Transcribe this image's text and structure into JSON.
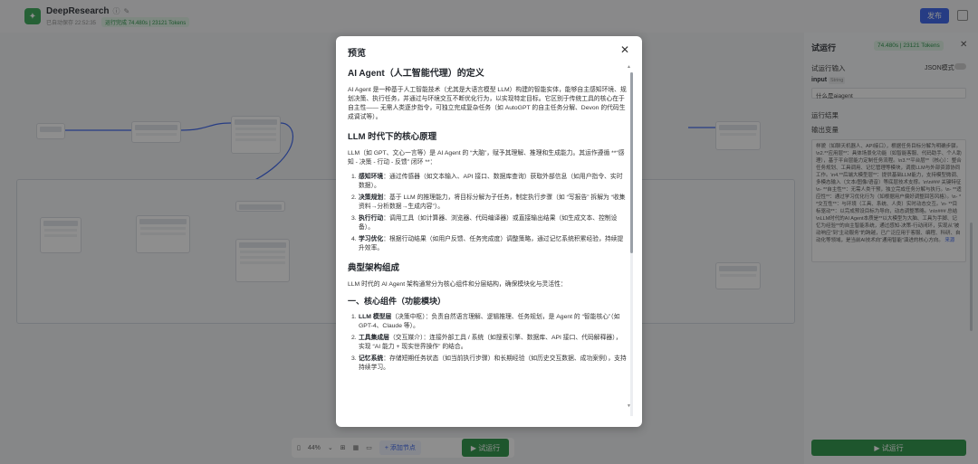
{
  "app": {
    "title": "DeepResearch",
    "save_status": "已自动保存 22:52:35",
    "run_status": "运行完成 74.480s | 23121 Tokens",
    "publish_label": "发布"
  },
  "toolbar": {
    "zoom": "44%",
    "add_node_label": "+ 添加节点",
    "run_label": "▶ 试运行"
  },
  "right_panel": {
    "title": "试运行",
    "status": "74.480s | 23121 Tokens",
    "input_section": "试运行输入",
    "json_mode_label": "JSON模式",
    "input_key": "input",
    "input_type": "String",
    "input_value": "什么是aiagent",
    "results_section": "运行结果",
    "output_label": "输出变量",
    "output_text": "样貌（如聊天机器人、API接口），根据任务目标分解为明确步骤。\\n2.**应用层**：具体场景化功能（如智能客服、代码助手、个人助理），基于平台层能力定制任务流程。\\n3.**平台层**（核心）：整合任务规划、工具调用、记忆管理等模块，调度LLM与外部资源协同工作。\\n4.**后端大模型层**：提供基础LLM能力，支持模型微调、多模态输入（文本/图像/语音）等底层技术支撑。\\n\\n### 关键特征 \\n- **自主性**：无需人类干预，独立完成任务分解与执行。\\n- **适应性**：通过学习优化行为（如根据用户偏好调整回答风格）。\\n- **交互性**：与环境（工具、系统、人类）实时动态交互。\\n- **目标驱动**：以完成预设目标为导向，动态调整策略。\\n\\n### 总结 \\nLLM时代的AI Agent本质是**以大模型为大脑、工具为手脚、记忆为经验**的自主智能系统，通过感知-决策-行动闭环，实现从“被动响应”到“主动服务”的跨越，已广泛应用于客服、编程、科研、自动化等领域，是当前AI技术向“通用智能”演进的核心方向。",
    "source_link": "来源",
    "run_button": "▶ 试运行"
  },
  "modal": {
    "title": "预览",
    "h_definition": "AI Agent（人工智能代理）的定义",
    "p_definition": "AI Agent 是一种基于人工智能技术（尤其是大语言模型 LLM）构建的智能实体，能够自主感知环境、规划决策、执行任务，并通过与环境交互不断优化行为，以实现特定目标。它区别于传统工具的核心在于自主性—— 无需人类逐步指令，可独立完成复杂任务（如 AutoGPT 的自主任务分解、Devon 的代码生成调试等）。",
    "h_principle": "LLM 时代下的核心原理",
    "p_principle": "LLM（如 GPT、文心一言等）是 AI Agent 的 “大脑”，赋予其理解、推理和生成能力。其运作遵循 **“感知 - 决策 - 行动 - 反馈” 闭环 **：",
    "principle_items": [
      {
        "num": "1.",
        "title": "感知环境",
        "text": "：通过传感器（如文本输入、API 接口、数据库查询）获取外部信息（如用户指令、实时数据）。"
      },
      {
        "num": "2.",
        "title": "决策规划",
        "text": "：基于 LLM 的推理能力，将目标分解为子任务，制定执行步骤（如 “写报告” 拆解为 “收集资料→分析数据→生成内容”）。"
      },
      {
        "num": "3.",
        "title": "执行行动",
        "text": "：调用工具（如计算器、浏览器、代码编译器）或直接输出结果（如生成文本、控制设备）。"
      },
      {
        "num": "4.",
        "title": "学习优化",
        "text": "：根据行动结果（如用户反馈、任务完成度）调整策略，通过记忆系统积累经验，持续提升效率。"
      }
    ],
    "h_architecture": "典型架构组成",
    "p_architecture": "LLM 时代的 AI Agent 架构通常分为核心组件和分层结构，确保模块化与灵活性：",
    "h_components": "一、核心组件（功能模块）",
    "component_items": [
      {
        "num": "1.",
        "title": "LLM 模型层",
        "text": "（决策中枢）：负责自然语言理解、逻辑推理、任务规划，是 Agent 的 “智能核心”（如 GPT-4、Claude 等）。"
      },
      {
        "num": "2.",
        "title": "工具集成层",
        "text": "（交互媒介）：连接外部工具 / 系统（如搜索引擎、数据库、API 接口、代码解释器），实现 “AI 能力 + 现实世界操作” 的结合。"
      },
      {
        "num": "3.",
        "title": "记忆系统",
        "text": "：存储短期任务状态（如当前执行步骤）和长期经验（如历史交互数据、成功案例），支持持续学习。"
      }
    ]
  }
}
